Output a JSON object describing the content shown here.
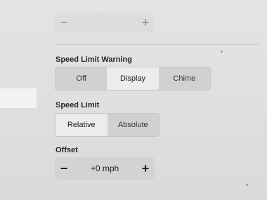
{
  "top_stepper": {
    "minus": "−",
    "value": "",
    "plus": "+"
  },
  "speed_limit_warning": {
    "label": "Speed Limit Warning",
    "options": [
      "Off",
      "Display",
      "Chime"
    ],
    "selected": "Display"
  },
  "speed_limit": {
    "label": "Speed Limit",
    "options": [
      "Relative",
      "Absolute"
    ],
    "selected": "Relative"
  },
  "offset": {
    "label": "Offset",
    "minus": "−",
    "value": "+0 mph",
    "plus": "+"
  }
}
